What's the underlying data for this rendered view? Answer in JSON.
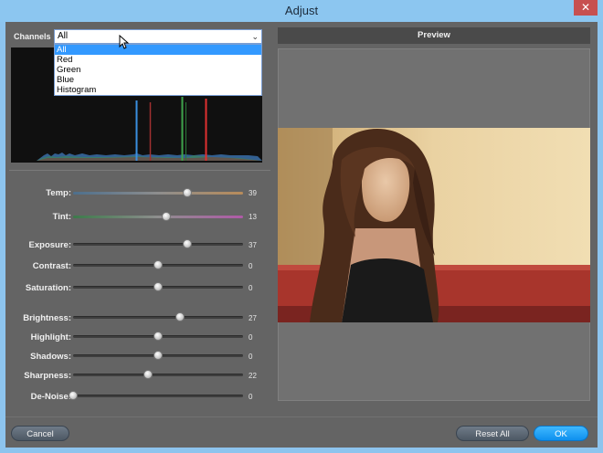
{
  "window": {
    "title": "Adjust",
    "close": "✕"
  },
  "channels": {
    "label": "Channels",
    "selected": "All",
    "options": [
      "All",
      "Red",
      "Green",
      "Blue",
      "Histogram"
    ]
  },
  "preview": {
    "header": "Preview"
  },
  "sliders": {
    "temp": {
      "label": "Temp:",
      "value": "39",
      "position": 0.67
    },
    "tint": {
      "label": "Tint:",
      "value": "13",
      "position": 0.55
    },
    "exposure": {
      "label": "Exposure:",
      "value": "37",
      "position": 0.67
    },
    "contrast": {
      "label": "Contrast:",
      "value": "0",
      "position": 0.5
    },
    "saturation": {
      "label": "Saturation:",
      "value": "0",
      "position": 0.5
    },
    "brightness": {
      "label": "Brightness:",
      "value": "27",
      "position": 0.63
    },
    "highlight": {
      "label": "Highlight:",
      "value": "0",
      "position": 0.5
    },
    "shadows": {
      "label": "Shadows:",
      "value": "0",
      "position": 0.5
    },
    "sharpness": {
      "label": "Sharpness:",
      "value": "22",
      "position": 0.44
    },
    "denoise": {
      "label": "De-Noise:",
      "value": "0",
      "position": 0.0
    }
  },
  "buttons": {
    "cancel": "Cancel",
    "reset_all": "Reset All",
    "ok": "OK"
  }
}
